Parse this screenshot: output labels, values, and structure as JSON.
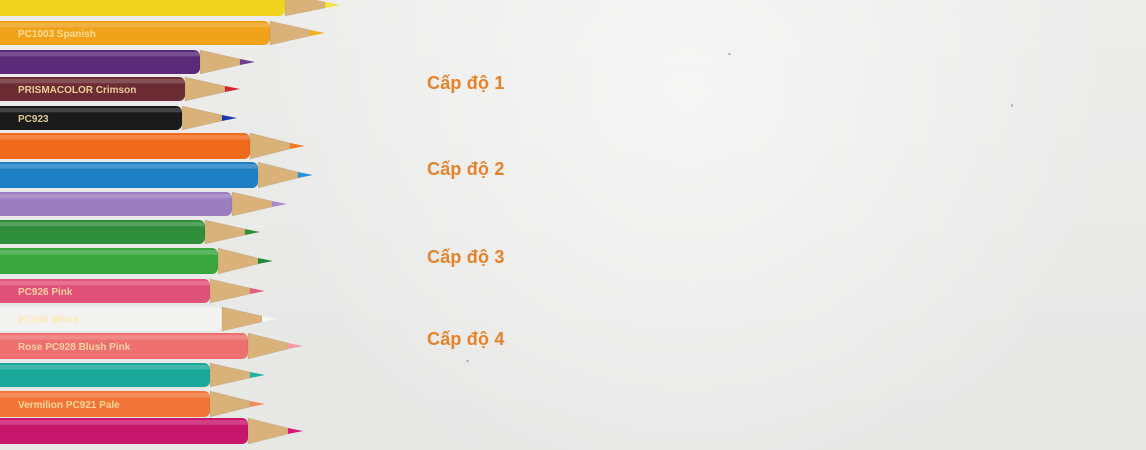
{
  "menu": {
    "items": [
      {
        "label": "Cấp độ 1"
      },
      {
        "label": "Cấp độ 2"
      },
      {
        "label": "Cấp độ 3"
      },
      {
        "label": "Cấp độ 4"
      }
    ]
  },
  "pencils": [
    {
      "color": "#f2d41e",
      "tip": "#f4e33a",
      "label": ""
    },
    {
      "color": "#f0a21a",
      "tip": "#f0b31b",
      "label": "PC1003  Spanish"
    },
    {
      "color": "#5b2a78",
      "tip": "#6c3a8f",
      "label": ""
    },
    {
      "color": "#6b2c33",
      "tip": "#d3232b",
      "label": "PRISMACOLOR  Crimson"
    },
    {
      "color": "#1a1a1a",
      "tip": "#1c37b4",
      "label": "PC923"
    },
    {
      "color": "#ef6a1b",
      "tip": "#f27a24",
      "label": ""
    },
    {
      "color": "#1f7fc4",
      "tip": "#2a92d8",
      "label": ""
    },
    {
      "color": "#9c7dc0",
      "tip": "#a78ad0",
      "label": ""
    },
    {
      "color": "#2f8e3a",
      "tip": "#2f8e3a",
      "label": ""
    },
    {
      "color": "#3aa63e",
      "tip": "#1f8a3a",
      "label": ""
    },
    {
      "color": "#e0517a",
      "tip": "#e85a82",
      "label": "PC926  Pink"
    },
    {
      "color": "#f2f2f0",
      "tip": "#f5f5f3",
      "label": "PC938  White"
    },
    {
      "color": "#ee6f6f",
      "tip": "#f29aa2",
      "label": "Rose  PC928  Blush Pink"
    },
    {
      "color": "#1aa89a",
      "tip": "#1fb3a6",
      "label": ""
    },
    {
      "color": "#f27436",
      "tip": "#f08a5a",
      "label": "Vermilion  PC921  Pale"
    },
    {
      "color": "#c8156c",
      "tip": "#d51a76",
      "label": ""
    }
  ]
}
